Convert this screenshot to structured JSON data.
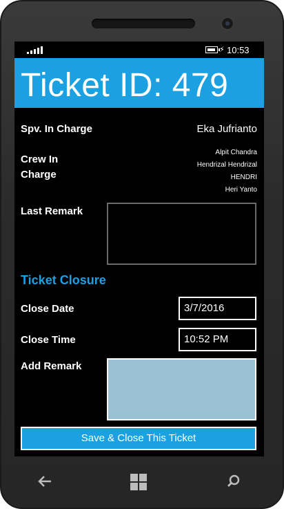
{
  "status_bar": {
    "time": "10:53",
    "signal_icon": "signal-strength-icon",
    "battery_icon": "battery-charging-icon"
  },
  "header": {
    "title": "Ticket ID: 479",
    "color": "#1ba1e2"
  },
  "details": {
    "spv_label": "Spv. In Charge",
    "spv_value": "Eka Jufrianto",
    "crew_label_line1": "Crew In",
    "crew_label_line2": "Charge",
    "crew_members": [
      "Alpit Chandra",
      "Hendrizal Hendrizal",
      "HENDRI",
      "Heri Yanto"
    ],
    "last_remark_label": "Last Remark",
    "last_remark_value": ""
  },
  "closure": {
    "section_title": "Ticket Closure",
    "close_date_label": "Close Date",
    "close_date_value": "3/7/2016",
    "close_time_label": "Close Time",
    "close_time_value": "10:52 PM",
    "add_remark_label": "Add Remark",
    "add_remark_value": ""
  },
  "actions": {
    "save_label": "Save & Close This Ticket"
  },
  "nav": {
    "back_icon": "back-arrow-icon",
    "start_icon": "windows-start-icon",
    "search_icon": "search-icon"
  }
}
